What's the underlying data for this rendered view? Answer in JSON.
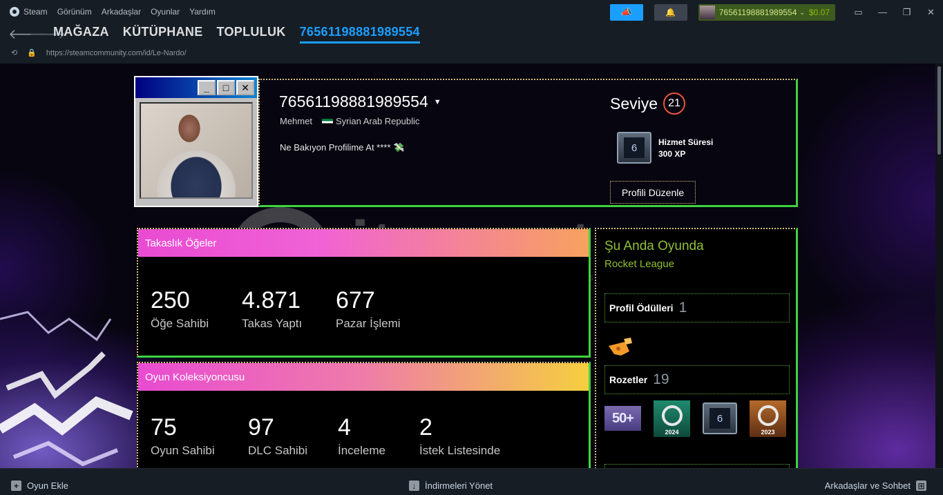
{
  "menu": {
    "app": "Steam",
    "items": [
      "Görünüm",
      "Arkadaşlar",
      "Oyunlar",
      "Yardım"
    ]
  },
  "account": {
    "name": "76561198881989554",
    "balance": "$0.07"
  },
  "nav": {
    "tabs": [
      "MAĞAZA",
      "KÜTÜPHANE",
      "TOPLULUK",
      "76561198881989554"
    ]
  },
  "url": "https://steamcommunity.com/id/Le-Nardo/",
  "profile": {
    "persona": "76561198881989554",
    "real_name": "Mehmet",
    "country": "Syrian Arab Republic",
    "summary": "Ne Bakıyon Profilime At **** 💸",
    "level_label": "Seviye",
    "level": "21",
    "fav_badge_value": "6",
    "fav_badge_name": "Hizmet Süresi",
    "fav_badge_xp": "300 XP",
    "edit_label": "Profili Düzenle"
  },
  "trade_showcase": {
    "title": "Takaslık Öğeler",
    "stats": [
      {
        "value": "250",
        "label": "Öğe Sahibi"
      },
      {
        "value": "4.871",
        "label": "Takas Yaptı"
      },
      {
        "value": "677",
        "label": "Pazar İşlemi"
      }
    ]
  },
  "collector_showcase": {
    "title": "Oyun Koleksiyoncusu",
    "stats": [
      {
        "value": "75",
        "label": "Oyun Sahibi"
      },
      {
        "value": "97",
        "label": "DLC Sahibi"
      },
      {
        "value": "4",
        "label": "İnceleme"
      },
      {
        "value": "2",
        "label": "İstek Listesinde"
      }
    ]
  },
  "right": {
    "ingame_header": "Şu Anda Oyunda",
    "ingame_game": "Rocket League",
    "awards_label": "Profil Ödülleri",
    "awards_count": "1",
    "badges_label": "Rozetler",
    "badges_count": "19",
    "badges": [
      {
        "text": "50+"
      },
      {
        "year": "2024"
      },
      {
        "text": "6"
      },
      {
        "year": "2023"
      }
    ]
  },
  "watermark": {
    "text": "itemsatış",
    "sub": "HESAP / SKIN / ITEM / E-PIN",
    "com": ".com"
  },
  "statusbar": {
    "add_game": "Oyun Ekle",
    "downloads": "İndirmeleri Yönet",
    "friends": "Arkadaşlar ve Sohbet"
  },
  "colors": {
    "accent": "#1a9fff",
    "ingame": "#8fbf36",
    "showcase_border": "#3fd43f"
  }
}
